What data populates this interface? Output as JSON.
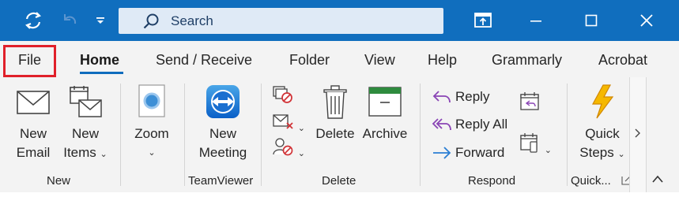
{
  "titlebar": {
    "search_placeholder": "Search",
    "icons": [
      "sync-icon",
      "undo-icon",
      "customize-qat-icon",
      "search-icon",
      "coming-soon-icon",
      "minimize-icon",
      "maximize-icon",
      "close-icon"
    ],
    "accent": "#106ebe"
  },
  "tabs": [
    "File",
    "Home",
    "Send / Receive",
    "Folder",
    "View",
    "Help",
    "Grammarly",
    "Acrobat"
  ],
  "active_tab": "Home",
  "groups": {
    "new": {
      "label": "New",
      "new_email": [
        "New",
        "Email"
      ],
      "new_items": [
        "New",
        "Items"
      ]
    },
    "zoom": {
      "label": "Zoom"
    },
    "teamviewer": {
      "label": "TeamViewer",
      "new_meeting": [
        "New",
        "Meeting"
      ]
    },
    "delete": {
      "label": "Delete",
      "delete": "Delete",
      "archive": "Archive"
    },
    "respond": {
      "label": "Respond",
      "reply": "Reply",
      "reply_all": "Reply All",
      "forward": "Forward"
    },
    "quick_steps": {
      "label": "Quick...",
      "button": [
        "Quick",
        "Steps"
      ]
    }
  }
}
